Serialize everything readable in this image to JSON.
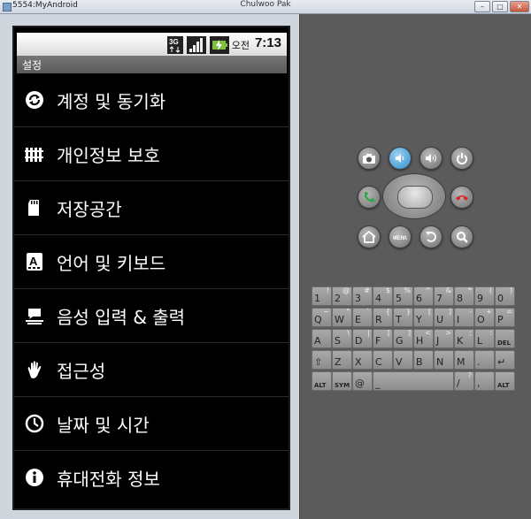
{
  "window": {
    "title_left": "5554:MyAndroid",
    "title_center": "Chulwoo Pak",
    "controls": [
      "minimize",
      "maximize",
      "close"
    ]
  },
  "status_bar": {
    "network": "3G",
    "ampm": "오전",
    "time": "7:13",
    "icons": [
      "3g-icon",
      "signal-icon",
      "battery-icon"
    ]
  },
  "app": {
    "title": "설정"
  },
  "settings_items": [
    {
      "label": "계정 및 동기화",
      "icon": "sync-icon"
    },
    {
      "label": "개인정보 보호",
      "icon": "privacy-icon"
    },
    {
      "label": "저장공간",
      "icon": "storage-icon"
    },
    {
      "label": "언어 및 키보드",
      "icon": "keyboard-language-icon"
    },
    {
      "label": "음성 입력 & 출력",
      "icon": "voice-io-icon"
    },
    {
      "label": "접근성",
      "icon": "accessibility-icon"
    },
    {
      "label": "날짜 및 시간",
      "icon": "clock-icon"
    },
    {
      "label": "휴대전화 정보",
      "icon": "info-icon"
    }
  ],
  "controls": {
    "top_row": [
      "camera-button",
      "volume-down-button",
      "volume-up-button",
      "power-button"
    ],
    "bottom_row": [
      "home-button",
      "menu-button",
      "back-button",
      "search-button"
    ],
    "menu_label": "MENU"
  },
  "keyboard": {
    "row1": [
      [
        "1",
        "!"
      ],
      [
        "2",
        "@"
      ],
      [
        "3",
        "#"
      ],
      [
        "4",
        "$"
      ],
      [
        "5",
        "%"
      ],
      [
        "6",
        "^"
      ],
      [
        "7",
        "&"
      ],
      [
        "8",
        "*"
      ],
      [
        "9",
        "("
      ],
      [
        "0",
        ")"
      ]
    ],
    "row2": [
      [
        "Q",
        "~"
      ],
      [
        "W",
        "\""
      ],
      [
        "E",
        "`"
      ],
      [
        "R",
        "{"
      ],
      [
        "T",
        "}"
      ],
      [
        "Y",
        "["
      ],
      [
        "U",
        "]"
      ],
      [
        "I",
        "-"
      ],
      [
        "O",
        "+"
      ],
      [
        "P",
        "="
      ]
    ],
    "row3": [
      [
        "A",
        ""
      ],
      [
        "S",
        "\\"
      ],
      [
        "D",
        "|"
      ],
      [
        "F",
        "["
      ],
      [
        "G",
        "]"
      ],
      [
        "H",
        "<"
      ],
      [
        "J",
        ">"
      ],
      [
        "K",
        ";"
      ],
      [
        "L",
        ":"
      ],
      [
        "DEL",
        ""
      ]
    ],
    "row4": [
      [
        "⇧",
        ""
      ],
      [
        "Z",
        ""
      ],
      [
        "X",
        ""
      ],
      [
        "C",
        ""
      ],
      [
        "V",
        ""
      ],
      [
        "B",
        ""
      ],
      [
        "N",
        ""
      ],
      [
        "M",
        ""
      ],
      [
        ".",
        ""
      ],
      [
        "↵",
        ""
      ]
    ],
    "row5": [
      [
        "ALT",
        ""
      ],
      [
        "SYM",
        ""
      ],
      [
        "@",
        ""
      ],
      [
        "_",
        ""
      ],
      [
        "/",
        "?"
      ],
      [
        ",",
        ""
      ],
      [
        "ALT",
        ""
      ]
    ]
  }
}
